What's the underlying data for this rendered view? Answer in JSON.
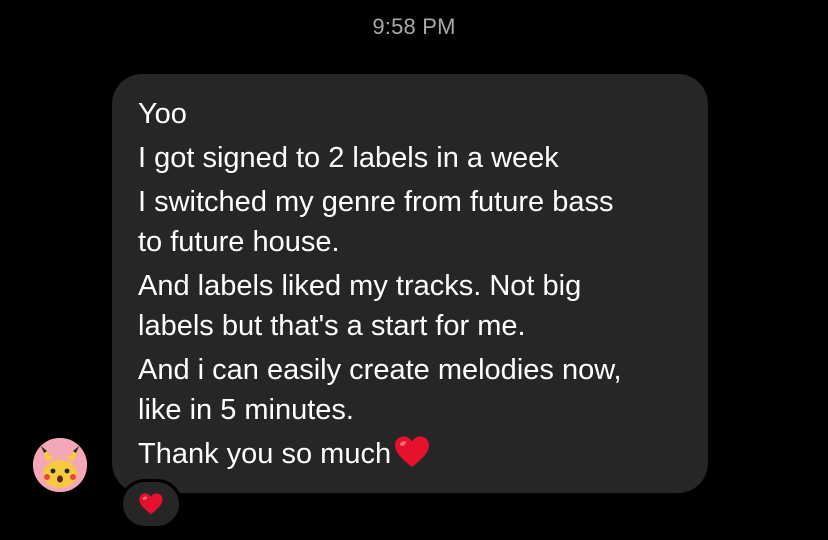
{
  "conversation": {
    "timestamp": "9:58 PM"
  },
  "message": {
    "lines": [
      "Yoo",
      "I got signed to 2 labels in a week",
      "I switched my genre from future bass",
      "to future house.",
      "And labels liked my tracks. Not big",
      "labels but that's a start for me.",
      "And i can easily create melodies now,",
      "like in 5 minutes.",
      "Thank you so much"
    ],
    "trailing_emoji": "heart-icon",
    "reaction": "heart-icon"
  },
  "colors": {
    "background": "#000000",
    "bubble": "#262626",
    "text": "#ffffff",
    "timestamp": "#a8a8a8",
    "heart": "#e8112d",
    "avatar_bg": "#f3a7b7"
  }
}
